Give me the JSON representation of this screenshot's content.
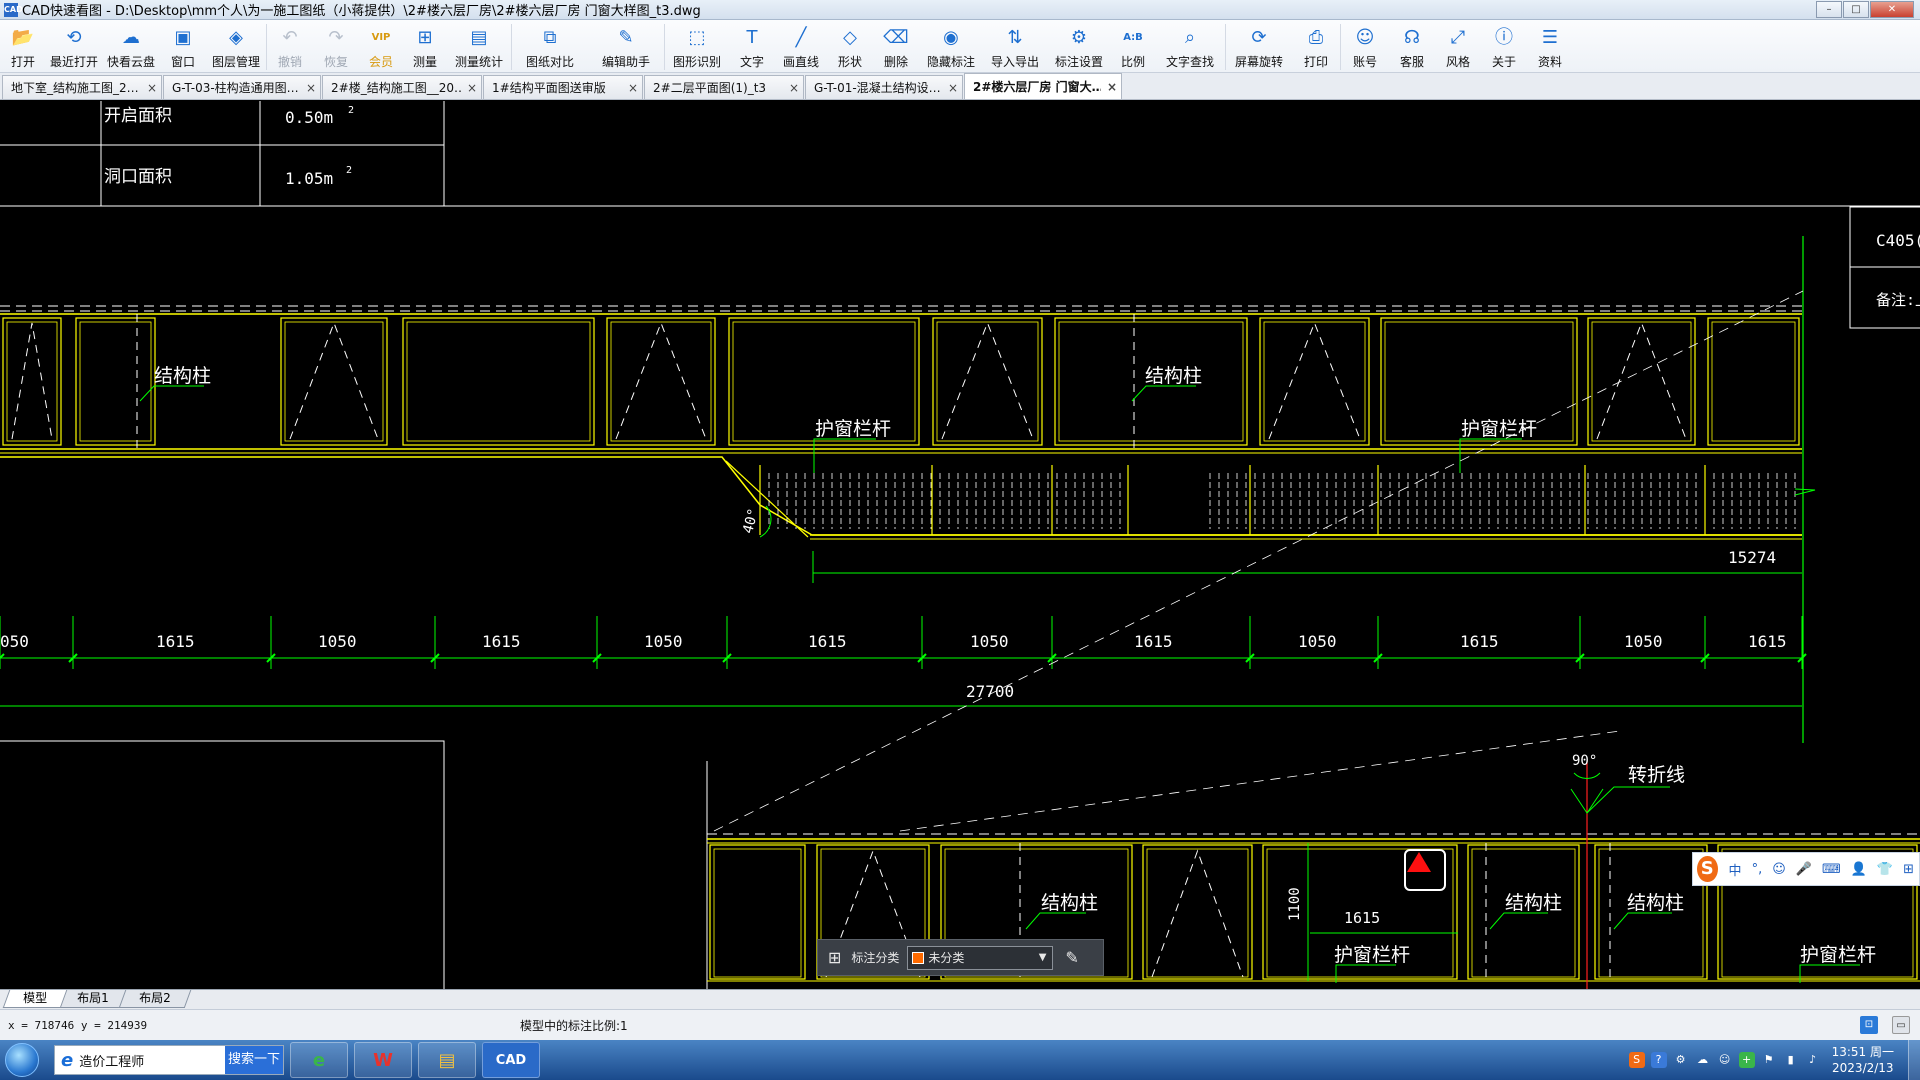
{
  "window": {
    "title": "CAD快速看图 - D:\\Desktop\\mm个人\\为一施工图纸（小蒋提供）\\2#楼六层厂房\\2#楼六层厂房 门窗大样图_t3.dwg",
    "controls": {
      "minimize": "–",
      "maximize": "□",
      "close": "✕"
    }
  },
  "toolbar": [
    {
      "label": "打开",
      "icon": "folder-icon",
      "glyph": "📂",
      "state": "normal"
    },
    {
      "label": "最近打开",
      "icon": "clock-icon",
      "glyph": "⟲",
      "state": "normal"
    },
    {
      "label": "快看云盘",
      "icon": "cloud-icon",
      "glyph": "☁",
      "state": "normal"
    },
    {
      "label": "窗口",
      "icon": "window-icon",
      "glyph": "▣",
      "state": "normal"
    },
    {
      "label": "图层管理",
      "icon": "layers-icon",
      "glyph": "◈",
      "state": "normal"
    },
    {
      "label": "撤销",
      "icon": "undo-icon",
      "glyph": "↶",
      "state": "disabled"
    },
    {
      "label": "恢复",
      "icon": "redo-icon",
      "glyph": "↷",
      "state": "disabled"
    },
    {
      "label": "会员",
      "icon": "vip-icon",
      "glyph": "VIP",
      "state": "vip"
    },
    {
      "label": "测量",
      "icon": "ruler-icon",
      "glyph": "⊞",
      "state": "normal"
    },
    {
      "label": "测量统计",
      "icon": "measure-stats-icon",
      "glyph": "▤",
      "state": "normal"
    },
    {
      "label": "图纸对比",
      "icon": "compare-icon",
      "glyph": "⧉",
      "state": "normal"
    },
    {
      "label": "编辑助手",
      "icon": "edit-helper-icon",
      "glyph": "✎",
      "state": "normal"
    },
    {
      "label": "图形识别",
      "icon": "shape-recognize-icon",
      "glyph": "⬚",
      "state": "normal"
    },
    {
      "label": "文字",
      "icon": "text-icon",
      "glyph": "T",
      "state": "normal"
    },
    {
      "label": "画直线",
      "icon": "line-icon",
      "glyph": "╱",
      "state": "normal"
    },
    {
      "label": "形状",
      "icon": "shape-icon",
      "glyph": "◇",
      "state": "normal"
    },
    {
      "label": "删除",
      "icon": "eraser-icon",
      "glyph": "⌫",
      "state": "normal"
    },
    {
      "label": "隐藏标注",
      "icon": "eye-hidden-icon",
      "glyph": "◉",
      "state": "normal"
    },
    {
      "label": "导入导出",
      "icon": "import-export-icon",
      "glyph": "⇅",
      "state": "normal"
    },
    {
      "label": "标注设置",
      "icon": "annotation-settings-icon",
      "glyph": "⚙",
      "state": "normal"
    },
    {
      "label": "比例",
      "icon": "scale-icon",
      "glyph": "A:B",
      "state": "normal"
    },
    {
      "label": "文字查找",
      "icon": "text-search-icon",
      "glyph": "⌕",
      "state": "normal"
    },
    {
      "label": "屏幕旋转",
      "icon": "rotate-icon",
      "glyph": "⟳",
      "state": "normal"
    },
    {
      "label": "打印",
      "icon": "printer-icon",
      "glyph": "⎙",
      "state": "normal"
    },
    {
      "label": "账号",
      "icon": "user-icon",
      "glyph": "☺",
      "state": "normal"
    },
    {
      "label": "客服",
      "icon": "headset-icon",
      "glyph": "☊",
      "state": "normal"
    },
    {
      "label": "风格",
      "icon": "style-icon",
      "glyph": "⤢",
      "state": "normal"
    },
    {
      "label": "关于",
      "icon": "info-icon",
      "glyph": "ⓘ",
      "state": "normal"
    },
    {
      "label": "资料",
      "icon": "docs-icon",
      "glyph": "☰",
      "state": "normal"
    }
  ],
  "tabs": [
    {
      "label": "地下室_结构施工图_2…",
      "active": false
    },
    {
      "label": "G-T-03-柱构造通用图…",
      "active": false
    },
    {
      "label": "2#楼_结构施工图__20…",
      "active": false
    },
    {
      "label": "1#结构平面图送审版",
      "active": false
    },
    {
      "label": "2#二层平面图(1)_t3",
      "active": false
    },
    {
      "label": "G-T-01-混凝土结构设…",
      "active": false
    },
    {
      "label": "2#楼六层厂房 门窗大…",
      "active": true
    }
  ],
  "drawing": {
    "table": [
      {
        "label": "开启面积",
        "value": "0.50m",
        "sup": "2"
      },
      {
        "label": "洞口面积",
        "value": "1.05m",
        "sup": "2"
      }
    ],
    "legend_box": [
      "C405(",
      "备注:上悬"
    ],
    "labels_column": [
      "结构柱",
      "结构柱"
    ],
    "labels_railing": [
      "护窗栏杆",
      "护窗栏杆"
    ],
    "angle_40": "40°",
    "dim_15274": "15274",
    "dims_row": [
      "050",
      "1615",
      "1050",
      "1615",
      "1050",
      "1615",
      "1050",
      "1615",
      "1050",
      "1615",
      "1050",
      "1615"
    ],
    "dim_total": "27700",
    "angle_90": "90°",
    "break_line": "转折线",
    "lower_labels_column": [
      "结构柱",
      "结构柱",
      "结构柱"
    ],
    "lower_labels_railing": [
      "护窗栏杆",
      "护窗栏杆"
    ],
    "dim_1100": "1100",
    "dim_1615_lower": "1615"
  },
  "annotation_bar": {
    "label": "标注分类",
    "selected": "未分类",
    "swatch_color": "#ff6a00"
  },
  "ime": {
    "logo": "S",
    "items": [
      "中",
      "°,",
      "☺",
      "🎤",
      "⌨",
      "👤",
      "👕",
      "⊞"
    ]
  },
  "layout_tabs": [
    {
      "label": "模型",
      "active": true
    },
    {
      "label": "布局1",
      "active": false
    },
    {
      "label": "布局2",
      "active": false
    }
  ],
  "status": {
    "coords": "x = 718746  y = 214939",
    "scale_text": "模型中的标注比例:1"
  },
  "taskbar": {
    "search_placeholder": "造价工程师",
    "search_button": "搜索一下",
    "apps": [
      {
        "name": "browser",
        "glyph": "e",
        "color": "#3ab54a"
      },
      {
        "name": "wps",
        "glyph": "W",
        "color": "#e8322c"
      },
      {
        "name": "explorer",
        "glyph": "▤",
        "color": "#f0c040"
      },
      {
        "name": "cad",
        "glyph": "CAD",
        "color": "#2a6ac8"
      }
    ],
    "time": "13:51 周一",
    "date": "2023/2/13"
  },
  "colors": {
    "cad_yellow": "#ffff00",
    "cad_green": "#00ff00",
    "cad_white": "#ffffff",
    "accent_blue": "#1e6fd0"
  }
}
